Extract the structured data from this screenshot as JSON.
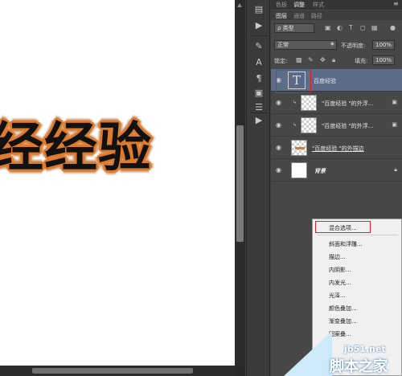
{
  "canvas": {
    "text": "经经验"
  },
  "panel": {
    "top_tabs": [
      "色板",
      "调整",
      "样式"
    ],
    "active_top_tab": 1,
    "sub_tabs": [
      "图层",
      "通道",
      "路径"
    ],
    "active_sub_tab": 0,
    "filter_kind": "ρ 类型",
    "blend_mode": "正常",
    "opacity_label": "不透明度:",
    "opacity_value": "100%",
    "lock_label": "锁定:",
    "fill_label": "填充:",
    "fill_value": "100%"
  },
  "layers": [
    {
      "name": "百度经验",
      "type": "text",
      "selected": true
    },
    {
      "name": "\"百度经验 \"的外浮...",
      "type": "clipped"
    },
    {
      "name": "\"百度经验 \"的外浮...",
      "type": "clipped"
    },
    {
      "name": "\"百度经验 \"的外描边",
      "type": "stroke"
    },
    {
      "name": "背景",
      "type": "background",
      "locked": true
    }
  ],
  "context_menu": {
    "items": [
      "混合选项...",
      "斜面和浮雕...",
      "描边...",
      "内阴影...",
      "内发光...",
      "光泽...",
      "颜色叠加...",
      "渐变叠加...",
      "图案叠..."
    ],
    "highlighted_index": 0
  },
  "watermark": {
    "line1": "jb51.net",
    "line2": "脚本之家"
  },
  "colors": {
    "selected_row": "#5d6d89",
    "highlight_box": "#e02020",
    "stroke_orange": "#e07a2b"
  }
}
